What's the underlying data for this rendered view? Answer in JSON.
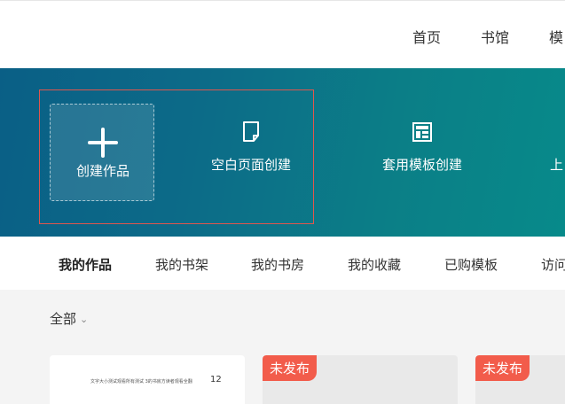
{
  "topnav": {
    "items": [
      "首页",
      "书馆",
      "模"
    ]
  },
  "banner": {
    "create_label": "创建作品",
    "options": [
      {
        "label": "空白页面创建",
        "icon": "blank-page-icon"
      },
      {
        "label": "套用模板创建",
        "icon": "template-icon"
      },
      {
        "label": "上",
        "icon": "upload-icon"
      }
    ]
  },
  "tabs": [
    "我的作品",
    "我的书架",
    "我的书房",
    "我的收藏",
    "已购模板",
    "访问"
  ],
  "filter": {
    "label": "全部",
    "icon": "chevron-down-icon"
  },
  "cards": [
    {
      "preview_text": "文字大小测试观看所有测试 3的书房方读者观看全翻",
      "number": "12"
    },
    {
      "badge": "未发布"
    },
    {
      "badge": "未发布"
    }
  ],
  "colors": {
    "accent_red": "#f25c4b",
    "banner_start": "#0a5f86",
    "banner_end": "#078a8a"
  }
}
